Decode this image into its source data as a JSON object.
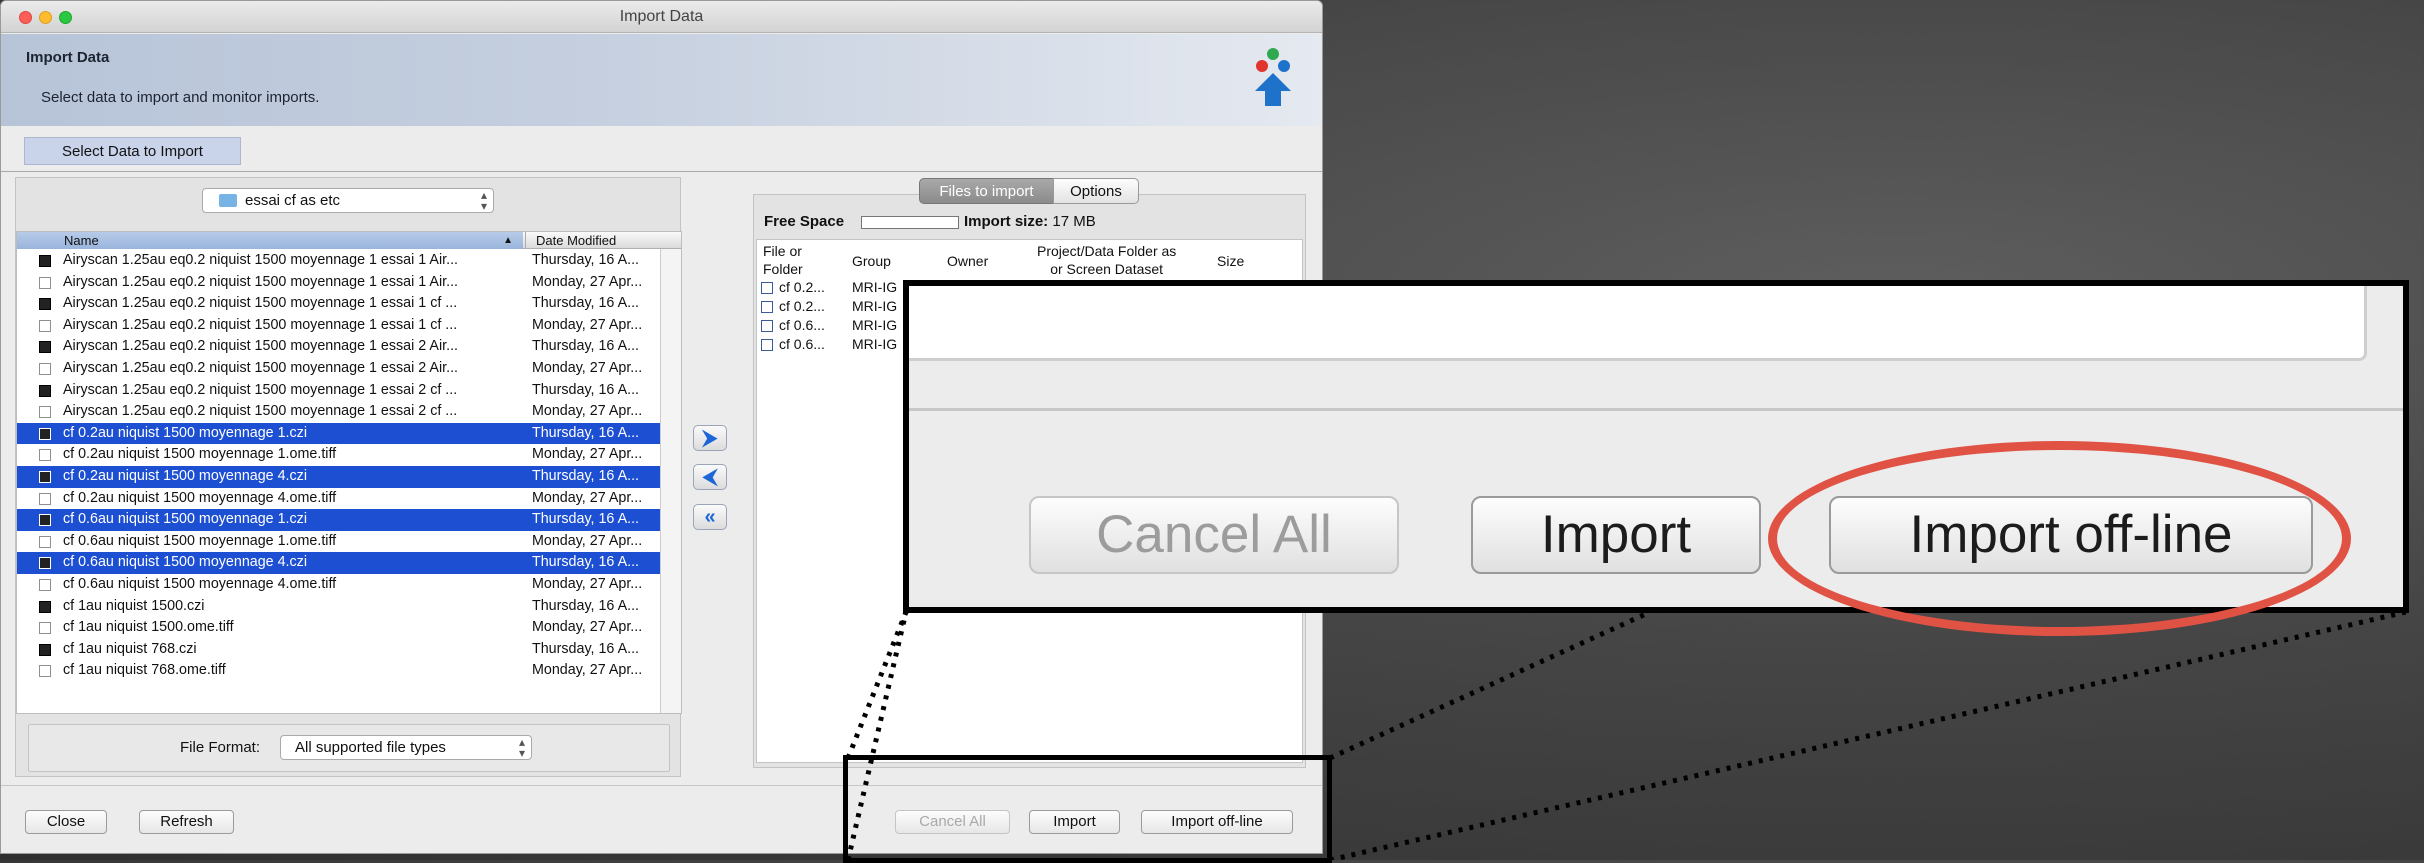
{
  "window": {
    "title": "Import Data",
    "banner_title": "Import Data",
    "banner_subtitle": "Select data to import and monitor imports.",
    "tab_select_label": "Select Data to Import"
  },
  "colors": {
    "selection": "#1d4fd3",
    "banner_blue": "#b7c4d8",
    "highlight_ring": "#e05244",
    "logo_red": "#e0342c",
    "logo_green": "#2fa84f",
    "logo_blue": "#1f72c9"
  },
  "icons": [
    "close-light",
    "minimize-light",
    "zoom-light",
    "app-logo-icon",
    "folder-icon",
    "add-arrow-icon",
    "remove-arrow-icon",
    "remove-all-arrow-icon",
    "file-icon",
    "sort-arrow-icon"
  ],
  "chooser": {
    "folder_name": "essai cf as etc",
    "columns": [
      "Name",
      "Date Modified"
    ],
    "files": [
      {
        "name": "Airyscan 1.25au  eq0.2 niquist 1500 moyennage 1 essai 1 Air...",
        "date": "Thursday, 16 A...",
        "icon": "dark",
        "selected": false
      },
      {
        "name": "Airyscan 1.25au  eq0.2 niquist 1500 moyennage 1 essai 1 Air...",
        "date": "Monday, 27 Apr...",
        "icon": "doc",
        "selected": false
      },
      {
        "name": "Airyscan 1.25au  eq0.2 niquist 1500 moyennage 1 essai 1 cf ...",
        "date": "Thursday, 16 A...",
        "icon": "dark",
        "selected": false
      },
      {
        "name": "Airyscan 1.25au  eq0.2 niquist 1500 moyennage 1 essai 1 cf ...",
        "date": "Monday, 27 Apr...",
        "icon": "doc",
        "selected": false
      },
      {
        "name": "Airyscan 1.25au  eq0.2 niquist 1500 moyennage 1 essai 2 Air...",
        "date": "Thursday, 16 A...",
        "icon": "dark",
        "selected": false
      },
      {
        "name": "Airyscan 1.25au  eq0.2 niquist 1500 moyennage 1 essai 2 Air...",
        "date": "Monday, 27 Apr...",
        "icon": "doc",
        "selected": false
      },
      {
        "name": "Airyscan 1.25au  eq0.2 niquist 1500 moyennage 1 essai 2 cf ...",
        "date": "Thursday, 16 A...",
        "icon": "dark",
        "selected": false
      },
      {
        "name": "Airyscan 1.25au  eq0.2 niquist 1500 moyennage 1 essai 2 cf ...",
        "date": "Monday, 27 Apr...",
        "icon": "doc",
        "selected": false
      },
      {
        "name": "cf 0.2au niquist 1500 moyennage 1.czi",
        "date": "Thursday, 16 A...",
        "icon": "dark",
        "selected": true
      },
      {
        "name": "cf 0.2au niquist 1500 moyennage 1.ome.tiff",
        "date": "Monday, 27 Apr...",
        "icon": "doc",
        "selected": false
      },
      {
        "name": "cf 0.2au niquist 1500 moyennage 4.czi",
        "date": "Thursday, 16 A...",
        "icon": "dark",
        "selected": true
      },
      {
        "name": "cf 0.2au niquist 1500 moyennage 4.ome.tiff",
        "date": "Monday, 27 Apr...",
        "icon": "doc",
        "selected": false
      },
      {
        "name": "cf 0.6au niquist 1500 moyennage 1.czi",
        "date": "Thursday, 16 A...",
        "icon": "dark",
        "selected": true
      },
      {
        "name": "cf 0.6au niquist 1500 moyennage 1.ome.tiff",
        "date": "Monday, 27 Apr...",
        "icon": "doc",
        "selected": false
      },
      {
        "name": "cf 0.6au niquist 1500 moyennage 4.czi",
        "date": "Thursday, 16 A...",
        "icon": "dark",
        "selected": true
      },
      {
        "name": "cf 0.6au niquist 1500 moyennage 4.ome.tiff",
        "date": "Monday, 27 Apr...",
        "icon": "doc",
        "selected": false
      },
      {
        "name": "cf 1au niquist 1500.czi",
        "date": "Thursday, 16 A...",
        "icon": "dark",
        "selected": false
      },
      {
        "name": "cf 1au niquist 1500.ome.tiff",
        "date": "Monday, 27 Apr...",
        "icon": "doc",
        "selected": false
      },
      {
        "name": "cf 1au niquist 768.czi",
        "date": "Thursday, 16 A...",
        "icon": "dark",
        "selected": false
      },
      {
        "name": "cf 1au niquist 768.ome.tiff",
        "date": "Monday, 27 Apr...",
        "icon": "doc",
        "selected": false
      }
    ],
    "file_format_label": "File Format:",
    "file_format_value": "All supported file types"
  },
  "transfer": {
    "add": "⮞",
    "remove": "⮜",
    "remove_all": "«"
  },
  "queue": {
    "tab_files": "Files to import",
    "tab_options": "Options",
    "free_space_label": "Free Space",
    "import_size_label": "Import size:",
    "import_size_value": "17 MB",
    "header_file": "File or\nFolder",
    "header_group": "Group",
    "header_owner": "Owner",
    "header_project": "Project/Data Folder as\nor Screen Dataset",
    "header_size": "Size",
    "rows": [
      {
        "file": "cf 0.2...",
        "group": "MRI-IG"
      },
      {
        "file": "cf 0.2...",
        "group": "MRI-IG"
      },
      {
        "file": "cf 0.6...",
        "group": "MRI-IG"
      },
      {
        "file": "cf 0.6...",
        "group": "MRI-IG"
      }
    ]
  },
  "footer": {
    "close": "Close",
    "refresh": "Refresh",
    "cancel_all": "Cancel All",
    "import": "Import",
    "import_offline": "Import off-line"
  },
  "zoom": {
    "cancel_all": "Cancel All",
    "import": "Import",
    "import_offline": "Import off-line"
  }
}
